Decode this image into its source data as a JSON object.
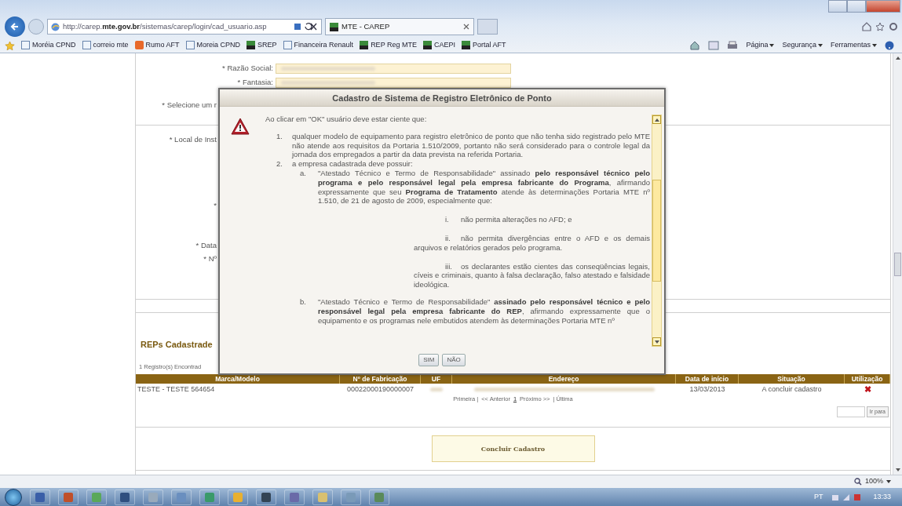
{
  "browser": {
    "url": "http://carep.**mte.gov.br**/sistemas/carep/login/cad_usuario.asp",
    "tabs": [
      {
        "label": "MTE - CAREP",
        "selected": true
      }
    ],
    "favorites": [
      {
        "label": "Moréia CPND",
        "kind": "page"
      },
      {
        "label": "correio mte",
        "kind": "page"
      },
      {
        "label": "Rumo AFT",
        "kind": "orange"
      },
      {
        "label": "Moreia CPND",
        "kind": "page"
      },
      {
        "label": "SREP",
        "kind": "site"
      },
      {
        "label": "Financeira Renault",
        "kind": "page"
      },
      {
        "label": "REP Reg MTE",
        "kind": "site"
      },
      {
        "label": "CAEPI",
        "kind": "site"
      },
      {
        "label": "Portal AFT",
        "kind": "site"
      }
    ],
    "menus": [
      "Página",
      "Segurança",
      "Ferramentas"
    ],
    "zoom": "100%"
  },
  "form": {
    "sections": [
      {
        "rows": [
          {
            "kind": "field",
            "label": "* Razão Social:"
          },
          {
            "kind": "field",
            "label": "* Fantasia:"
          },
          {
            "kind": "label",
            "label": "* Selecione um r"
          }
        ]
      },
      {
        "rows": [
          {
            "kind": "label",
            "label": "* Local de Inst"
          },
          {
            "kind": "label",
            "label": "*"
          },
          {
            "kind": "label",
            "label": "* Data"
          },
          {
            "kind": "label",
            "label": "* Nº"
          }
        ]
      }
    ]
  },
  "reps": {
    "title": "REPs Cadastrade",
    "count": "1 Registro(s) Encontrad",
    "columns": [
      "Marca/Modelo",
      "Nº de Fabricação",
      "UF",
      "Endereço",
      "Data de início",
      "Situação",
      "Utilização"
    ],
    "rows": [
      {
        "model": "TESTE - TESTE 564654",
        "serial": "00022000190000007",
        "start": "13/03/2013",
        "status": "A concluir cadastro",
        "action": "✖"
      }
    ],
    "pagination": {
      "first": "Primeira |",
      "prev": "<< Anterior",
      "page": "1",
      "next": "Próximo >>",
      "last": "| Última"
    },
    "goto_button": "Ir para"
  },
  "finish_button": "Concluir Cadastro",
  "dialog": {
    "title": "Cadastro de Sistema de Registro Eletrônico de Ponto",
    "intro": "Ao clicar em \"OK\" usuário deve estar ciente que:",
    "items": [
      {
        "marker": "1.",
        "text": "qualquer modelo de equipamento para registro eletrônico de ponto que não tenha sido registrado pelo MTE não atende aos requisitos da Portaria 1.510/2009, portanto não será considerado para o controle legal da jornada dos empregados a partir da data prevista na referida Portaria."
      },
      {
        "marker": "2.",
        "text": "a empresa cadastrada deve possuir:",
        "children": [
          {
            "marker": "a.",
            "text": "\"Atestado Técnico e Termo de Responsabilidade\" assinado **pelo responsável técnico pelo programa e pelo responsável legal pela empresa fabricante do Programa**, afirmando expressamente que seu **Programa de Tratamento** atende às determinações Portaria MTE nº 1.510, de 21 de agosto de 2009, especialmente que:",
            "children": [
              {
                "marker": "i.",
                "text": "não permita alterações no AFD; e"
              },
              {
                "marker": "ii.",
                "text": "não permita divergências entre o AFD e os demais arquivos e relatórios gerados pelo programa."
              },
              {
                "marker": "iii.",
                "text": "os declarantes estão cientes das conseqüências legais, cíveis e criminais, quanto à falsa declaração, falso atestado e falsidade ideológica."
              }
            ]
          },
          {
            "marker": "b.",
            "text": "\"Atestado Técnico e Termo de Responsabilidade\" **assinado pelo responsável técnico e pelo responsável legal pela empresa fabricante do REP**, afirmando expressamente que o equipamento e os programas nele embutidos atendem às determinações Portaria MTE nº"
          }
        ]
      }
    ],
    "buttons": [
      "SIM",
      "NÃO"
    ]
  },
  "taskbar": {
    "language": "PT",
    "time": "13:33"
  }
}
